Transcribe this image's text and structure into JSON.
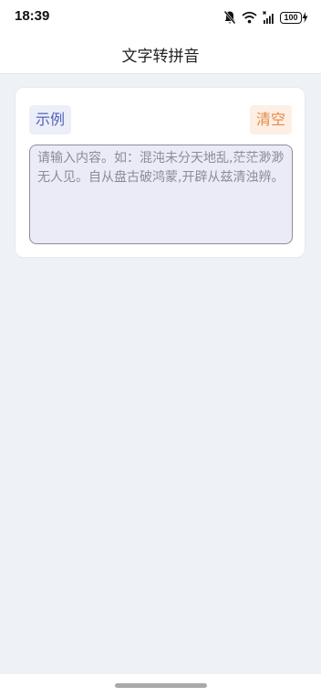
{
  "status_bar": {
    "time": "18:39",
    "battery_level": "100",
    "icons": [
      "bell-muted-icon",
      "wifi-icon",
      "signal-icon",
      "battery-icon",
      "charging-icon"
    ]
  },
  "header": {
    "title": "文字转拼音"
  },
  "card": {
    "example_label": "示例",
    "clear_label": "清空",
    "input_value": "",
    "input_placeholder": "请输入内容。如：混沌未分天地乱,茫茫渺渺无人见。自从盘古破鸿蒙,开辟从兹清浊辨。"
  },
  "colors": {
    "page_background": "#eef2f6",
    "example_button_text": "#5661b3",
    "example_button_bg": "#eceffa",
    "clear_button_text": "#e58a45",
    "clear_button_bg": "#fdefe4",
    "input_background": "#ebebf7"
  }
}
